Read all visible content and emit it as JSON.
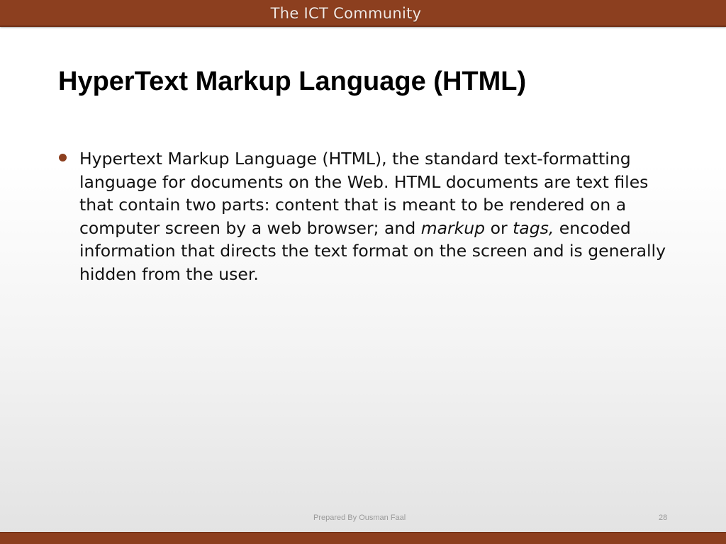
{
  "header": {
    "title": "The ICT Community"
  },
  "slide": {
    "title": "HyperText Markup Language (HTML)",
    "bullet": {
      "text_1": "Hypertext Markup Language (HTML), the standard text-formatting language for documents on the Web. HTML documents are text files that contain two parts: content that is meant to be rendered on a computer screen by a web browser; and ",
      "em_1": "markup",
      "text_2": " or ",
      "em_2": "tags,",
      "text_3": " encoded information that directs the text format on the screen and is generally hidden from the user."
    }
  },
  "footer": {
    "text": "Prepared By Ousman Faal",
    "page_number": "28"
  },
  "colors": {
    "accent": "#8c3f1f",
    "header_text": "#f4e8e2",
    "footer_text": "#9a9a9a"
  }
}
